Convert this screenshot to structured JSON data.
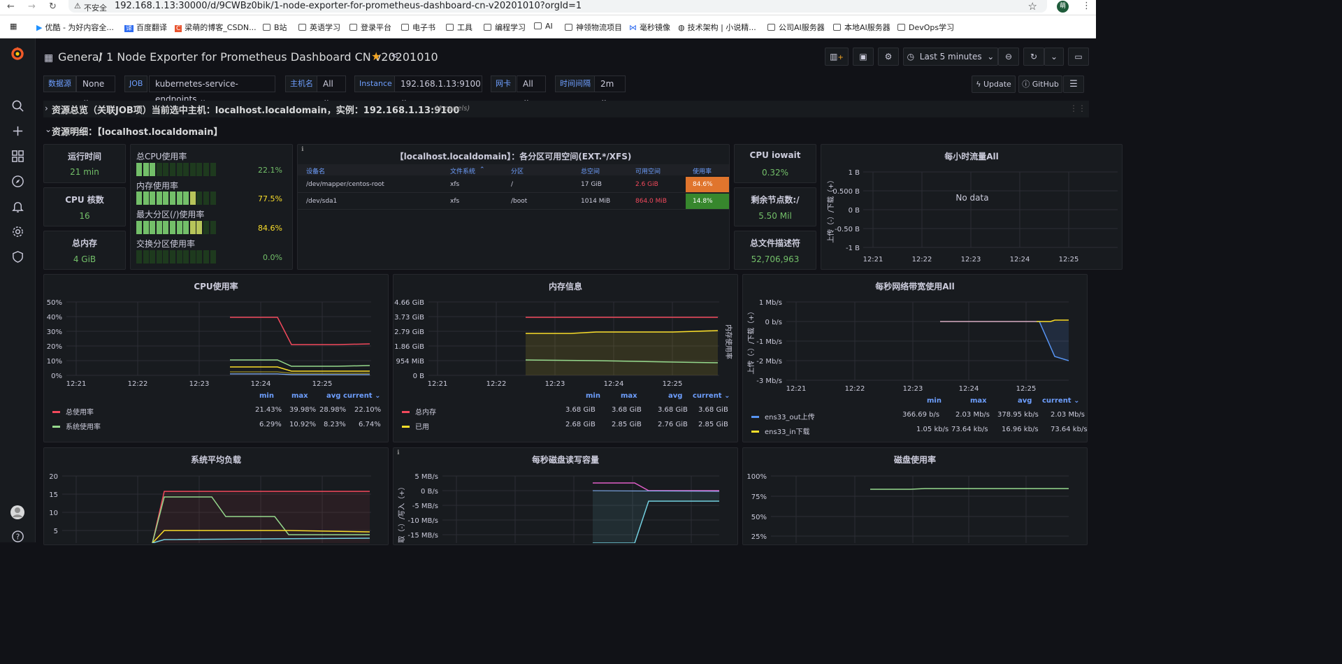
{
  "browser": {
    "insecure": "不安全",
    "url": "192.168.1.13:30000/d/9CWBz0bik/1-node-exporter-for-prometheus-dashboard-cn-v20201010?orgId=1",
    "avatar_letter": "萌"
  },
  "bookmarks": [
    "优酷 - 为好内容全...",
    "百度翻译",
    "梁萌的博客_CSDN...",
    "B站",
    "英语学习",
    "登录平台",
    "电子书",
    "工具",
    "编程学习",
    "AI",
    "神领物流项目",
    "毫秒镜像",
    "技术架构 | 小说精...",
    "公司AI服务器",
    "本地AI服务器",
    "DevOps学习"
  ],
  "header": {
    "folder": "General",
    "sep": "/",
    "title": "1 Node Exporter for Prometheus Dashboard CN v20201010",
    "time_range": "Last 5 minutes"
  },
  "vars": [
    {
      "label": "数据源",
      "value": "None"
    },
    {
      "label": "JOB",
      "value": "kubernetes-service-endpoints"
    },
    {
      "label": "主机名",
      "value": "All"
    },
    {
      "label": "Instance",
      "value": "192.168.1.13:9100"
    },
    {
      "label": "网卡",
      "value": "All"
    },
    {
      "label": "时间间隔",
      "value": "2m"
    }
  ],
  "links": {
    "update": "Update",
    "github": "GitHub"
  },
  "rows": {
    "collapsed": "资源总览（关联JOB项）当前选中主机：localhost.localdomain，实例：192.168.1.13:9100",
    "collapsed_count": "(4 panels)",
    "expanded": "资源明细：【localhost.localdomain】"
  },
  "stats": {
    "uptime": {
      "title": "运行时间",
      "value": "21 min"
    },
    "cores": {
      "title": "CPU 核数",
      "value": "16"
    },
    "memory": {
      "title": "总内存",
      "value": "4 GiB"
    },
    "iowait": {
      "title": "CPU iowait",
      "value": "0.32%"
    },
    "inodes": {
      "title": "剩余节点数:/",
      "value": "5.50 Mil"
    },
    "fds": {
      "title": "总文件描述符",
      "value": "52,706,963"
    }
  },
  "gauges": [
    {
      "label": "总CPU使用率",
      "value": "22.1%",
      "fill": 0.221,
      "color": "#73bf69"
    },
    {
      "label": "内存使用率",
      "value": "77.5%",
      "fill": 0.775,
      "color": "#fade2a"
    },
    {
      "label": "最大分区(/)使用率",
      "value": "84.6%",
      "fill": 0.846,
      "color": "#fade2a"
    },
    {
      "label": "交换分区使用率",
      "value": "0.0%",
      "fill": 0,
      "color": "#73bf69"
    }
  ],
  "partitions": {
    "title": "【localhost.localdomain】：各分区可用空间(EXT.*/XFS)",
    "headers": [
      "设备名",
      "文件系统",
      "分区",
      "总空间",
      "可用空间",
      "使用率"
    ],
    "rows": [
      [
        "/dev/mapper/centos-root",
        "xfs",
        "/",
        "17 GiB",
        "2.6 GiB",
        "84.6%"
      ],
      [
        "/dev/sda1",
        "xfs",
        "/boot",
        "1014 MiB",
        "864.0 MiB",
        "14.8%"
      ]
    ]
  },
  "traffic_hour": {
    "title": "每小时流量All",
    "no_data": "No data",
    "yticks": [
      "1 B",
      "0.500 B",
      "0 B",
      "-0.50 B",
      "-1 B"
    ],
    "xticks": [
      "12:21",
      "12:22",
      "12:23",
      "12:24",
      "12:25"
    ],
    "ylabel": "上传（-）/下载（+）"
  },
  "cpu": {
    "title": "CPU使用率",
    "yticks": [
      "50%",
      "40%",
      "30%",
      "20%",
      "10%",
      "0%"
    ],
    "xticks": [
      "12:21",
      "12:22",
      "12:23",
      "12:24",
      "12:25"
    ],
    "legend_cols": [
      "min",
      "max",
      "avg",
      "current"
    ],
    "legend": [
      {
        "name": "总使用率",
        "color": "#f2495c",
        "vals": [
          "21.43%",
          "39.98%",
          "28.98%",
          "22.10%"
        ]
      },
      {
        "name": "系统使用率",
        "color": "#96d98d",
        "vals": [
          "6.29%",
          "10.92%",
          "8.23%",
          "6.74%"
        ]
      }
    ]
  },
  "mem": {
    "title": "内存信息",
    "yticks": [
      "4.66 GiB",
      "3.73 GiB",
      "2.79 GiB",
      "1.86 GiB",
      "954 MiB",
      "0 B"
    ],
    "xticks": [
      "12:21",
      "12:22",
      "12:23",
      "12:24",
      "12:25"
    ],
    "ylabel": "内存使用率",
    "legend_cols": [
      "min",
      "max",
      "avg",
      "current"
    ],
    "legend": [
      {
        "name": "总内存",
        "color": "#f2495c",
        "vals": [
          "3.68 GiB",
          "3.68 GiB",
          "3.68 GiB",
          "3.68 GiB"
        ]
      },
      {
        "name": "已用",
        "color": "#fade2a",
        "vals": [
          "2.68 GiB",
          "2.85 GiB",
          "2.76 GiB",
          "2.85 GiB"
        ]
      }
    ]
  },
  "net": {
    "title": "每秒网络带宽使用All",
    "yticks": [
      "1 Mb/s",
      "0 b/s",
      "-1 Mb/s",
      "-2 Mb/s",
      "-3 Mb/s"
    ],
    "xticks": [
      "12:21",
      "12:22",
      "12:23",
      "12:24",
      "12:25"
    ],
    "ylabel": "上传（-）/下载（+）",
    "legend_cols": [
      "min",
      "max",
      "avg",
      "current"
    ],
    "legend": [
      {
        "name": "ens33_out上传",
        "color": "#5794f2",
        "vals": [
          "366.69 b/s",
          "2.03 Mb/s",
          "378.95 kb/s",
          "2.03 Mb/s"
        ]
      },
      {
        "name": "ens33_in下载",
        "color": "#fade2a",
        "vals": [
          "1.05 kb/s",
          "73.64 kb/s",
          "16.96 kb/s",
          "73.64 kb/s"
        ]
      }
    ]
  },
  "load": {
    "title": "系统平均负载",
    "yticks": [
      "20",
      "15",
      "10",
      "5"
    ]
  },
  "disk_io": {
    "title": "每秒磁盘读写容量",
    "yticks": [
      "5 MB/s",
      "0 B/s",
      "-5 MB/s",
      "-10 MB/s",
      "-15 MB/s"
    ],
    "ylabel": "读取（-）/写入（+）"
  },
  "disk_use": {
    "title": "磁盘使用率",
    "yticks": [
      "100%",
      "75%",
      "50%",
      "25%"
    ]
  }
}
